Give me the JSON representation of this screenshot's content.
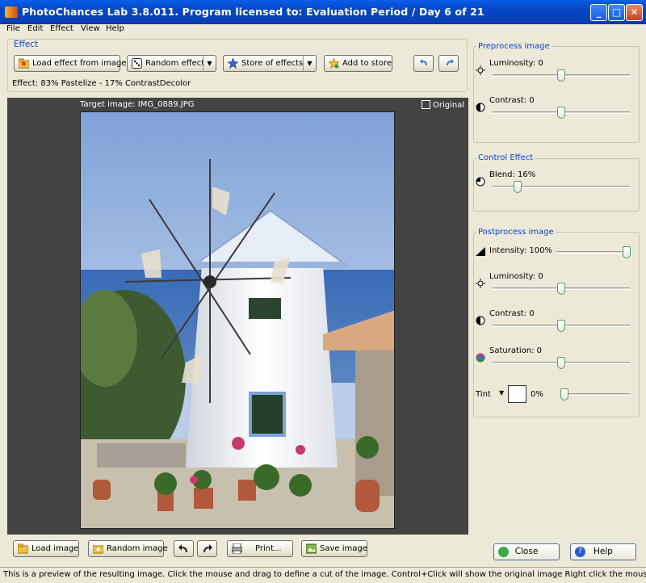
{
  "window": {
    "title": "PhotoChances Lab 3.8.011. Program licensed to: Evaluation Period / Day 6 of 21",
    "minimize_label": "_",
    "maximize_label": "□",
    "close_label": "✕"
  },
  "menu": [
    "File",
    "Edit",
    "Effect",
    "View",
    "Help"
  ],
  "effect_group": {
    "label": "Effect",
    "load_effect": "Load effect from image",
    "random_effect": "Random effect",
    "store_of_effects": "Store of effects",
    "add_to_store": "Add to store",
    "effect_text": "Effect:  83% Pastelize - 17% ContrastDecolor"
  },
  "preview": {
    "target_label": "Target image: IMG_0889.JPG",
    "original_label": "Original",
    "original_checked": false
  },
  "bottom_buttons": {
    "load_image": "Load image",
    "random_image": "Random image",
    "print": "Print...",
    "save_image": "Save image"
  },
  "status": "This is a preview of the resulting image. Click the mouse and drag to define a cut of the image. Control+Click will show the original image Right click the mouse for additional options",
  "preprocess": {
    "label": "Preprocess image",
    "luminosity": {
      "label": "Luminosity: 0",
      "value": 0
    },
    "contrast": {
      "label": "Contrast: 0",
      "value": 0
    }
  },
  "control_effect": {
    "label": "Control Effect",
    "blend": {
      "label": "Blend: 16%",
      "value": 16
    }
  },
  "postprocess": {
    "label": "Postprocess image",
    "intensity": {
      "label": "Intensity: 100%",
      "value": 100
    },
    "luminosity": {
      "label": "Luminosity: 0",
      "value": 0
    },
    "contrast": {
      "label": "Contrast: 0",
      "value": 0
    },
    "saturation": {
      "label": "Saturation: 0",
      "value": 0
    },
    "tint": {
      "label": "Tint",
      "percent": "0%",
      "value": 0,
      "color": "#ffffff"
    }
  },
  "actions": {
    "close": "Close",
    "help": "Help"
  },
  "colors": {
    "accent": "#0a46d0",
    "titlebar": "#0747c8",
    "preview_bg": "#434343"
  }
}
